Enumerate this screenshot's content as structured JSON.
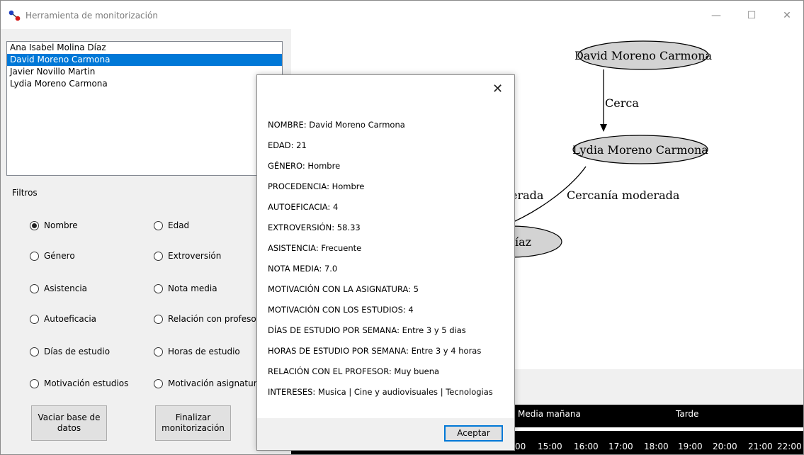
{
  "window": {
    "title": "Herramienta de monitorización",
    "minimize": "—",
    "maximize": "☐",
    "close": "✕"
  },
  "people": [
    "Ana Isabel Molina Díaz",
    "David Moreno Carmona",
    "Javier Novillo Martin",
    "Lydia Moreno Carmona"
  ],
  "filters": {
    "label": "Filtros",
    "left": [
      "Nombre",
      "Género",
      "Asistencia",
      "Autoeficacia",
      "Días de estudio",
      "Motivación estudios"
    ],
    "right": [
      "Edad",
      "Extroversión",
      "Nota media",
      "Relación con profeso",
      "Horas de estudio",
      "Motivación asignatur"
    ],
    "selected": "Nombre"
  },
  "buttons": {
    "clear_db": "Vaciar base de datos",
    "finish": "Finalizar monitorización"
  },
  "graph": {
    "node_david": "David Moreno Carmona",
    "node_lydia": "Lydia Moreno Carmona",
    "node_ana_partial": "íaz",
    "edge_cerca": "Cerca",
    "edge_moderada_left": "erada",
    "edge_moderada": "Cercanía moderada"
  },
  "timeline": {
    "label_media_manana": "Media mañana",
    "label_tarde": "Tarde",
    "ticks": [
      "00",
      "15:00",
      "16:00",
      "17:00",
      "18:00",
      "19:00",
      "20:00",
      "21:00",
      "22:00"
    ]
  },
  "dialog": {
    "close": "✕",
    "fields": [
      "NOMBRE: David Moreno Carmona",
      "EDAD: 21",
      "GÉNERO: Hombre",
      "PROCEDENCIA: Hombre",
      "AUTOEFICACIA: 4",
      "EXTROVERSIÓN: 58.33",
      "ASISTENCIA: Frecuente",
      "NOTA MEDIA: 7.0",
      "MOTIVACIÓN CON LA ASIGNATURA: 5",
      "MOTIVACIÓN CON LOS ESTUDIOS: 4",
      "DÍAS DE ESTUDIO POR SEMANA: Entre 3 y 5 dias",
      "HORAS DE ESTUDIO POR SEMANA: Entre 3 y 4 horas",
      "RELACIÓN CON EL PROFESOR: Muy buena",
      "INTERESES: Musica | Cine y audiovisuales | Tecnologias"
    ],
    "accept": "Aceptar"
  }
}
